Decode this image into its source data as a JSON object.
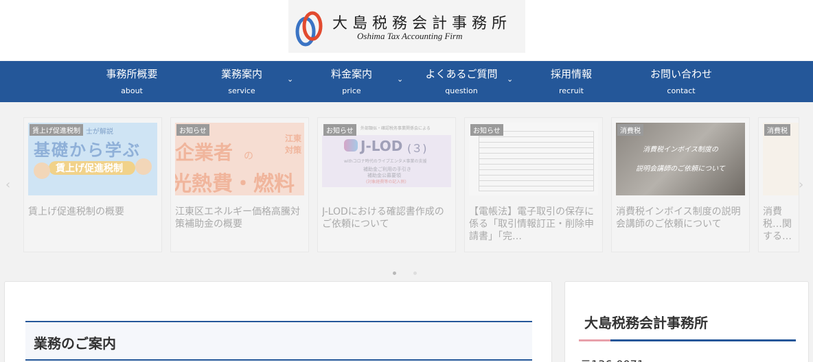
{
  "logo": {
    "name_jp": "大島税務会計事務所",
    "name_en": "Oshima Tax Accounting Firm"
  },
  "nav": {
    "items": [
      {
        "label": "事務所概要",
        "sub": "about",
        "dropdown": false
      },
      {
        "label": "業務案内",
        "sub": "service",
        "dropdown": true
      },
      {
        "label": "料金案内",
        "sub": "price",
        "dropdown": true
      },
      {
        "label": "よくあるご質問",
        "sub": "question",
        "dropdown": true
      },
      {
        "label": "採用情報",
        "sub": "recruit",
        "dropdown": false
      },
      {
        "label": "お問い合わせ",
        "sub": "contact",
        "dropdown": false
      }
    ]
  },
  "carousel": {
    "prev_icon": "chevron-left-icon",
    "next_icon": "chevron-right-icon",
    "cards": [
      {
        "badge": "賃上げ促進税制",
        "title": "賃上げ促進税制の概要",
        "thumb_text_small": "士が解説",
        "thumb_text_big": "基礎から学ぶ",
        "thumb_text_banner": "賃上げ促進税制"
      },
      {
        "badge": "お知らせ",
        "title": "江東区エネルギー価格高騰対策補助金の概要",
        "thumb_text_top": "企業者",
        "thumb_text_small": "の",
        "thumb_text_side": "江東 対策",
        "thumb_text_bottom": "光熱費・燃料"
      },
      {
        "badge": "お知らせ",
        "title": "J-LODにおける確認書作成のご依頼について",
        "thumb_text_small": "外部類似・確認税务事業関係会による",
        "thumb_text_logo": "J-LOD",
        "thumb_text_num": "(３)",
        "thumb_text_line1": "withコロナ時代のライブエンタメ事業の支援",
        "thumb_text_line2": "補助金ご利用の手引き",
        "thumb_text_line3": "補助金公募要領",
        "thumb_text_line4": "(対象経費等の記入例)"
      },
      {
        "badge": "お知らせ",
        "title": "【電帳法】電子取引の保存に係る「取引情報訂正・削除申請書」「完…"
      },
      {
        "badge": "消費税",
        "title": "消費税インボイス制度の説明会講師のご依頼について",
        "thumb_text_line1": "消費税インボイス制度の",
        "thumb_text_line2": "説明会講師のご依頼について"
      },
      {
        "badge": "消費税",
        "title": "消費税…関する…ついて"
      }
    ],
    "active_dot": 0,
    "dot_count": 2
  },
  "main": {
    "section_title": "業務のご案内"
  },
  "sidebar": {
    "title": "大島税務会計事務所",
    "address_start": "〒136-0071"
  },
  "colors": {
    "nav_bg": "#245799",
    "accent_pink": "#e8a0aa"
  }
}
